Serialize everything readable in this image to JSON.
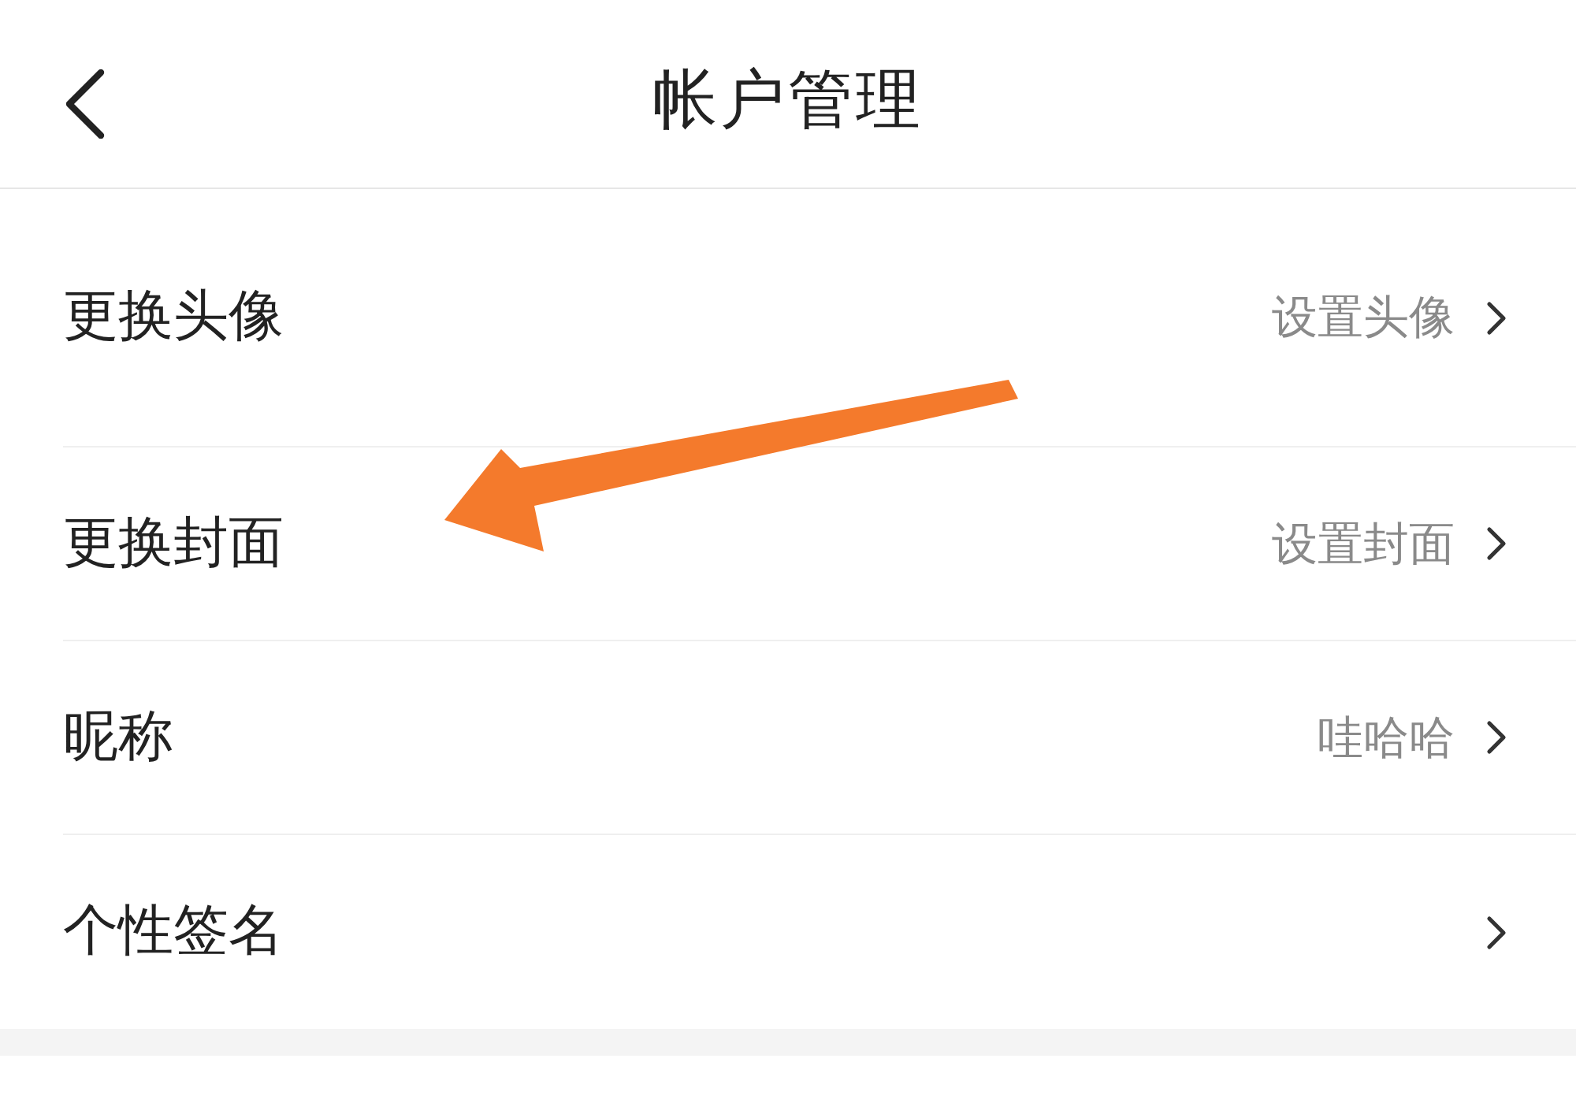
{
  "header": {
    "title": "帐户管理"
  },
  "rows": [
    {
      "label": "更换头像",
      "value": "设置头像"
    },
    {
      "label": "更换封面",
      "value": "设置封面"
    },
    {
      "label": "昵称",
      "value": "哇哈哈"
    },
    {
      "label": "个性签名"
    }
  ],
  "annotations": [
    {
      "kind": "arrow"
    }
  ]
}
